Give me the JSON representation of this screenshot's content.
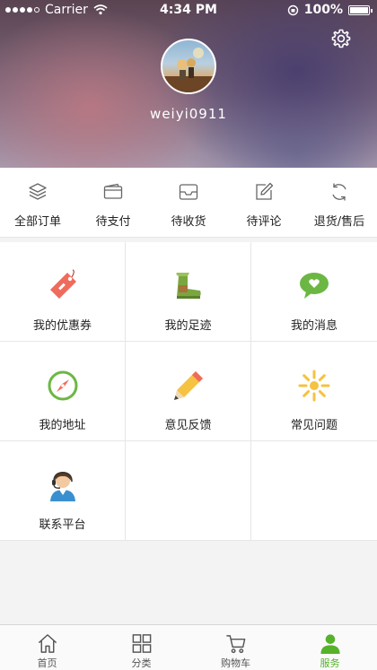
{
  "status_bar": {
    "carrier": "Carrier",
    "time": "4:34 PM",
    "battery": "100%",
    "battery_level": 1.0
  },
  "profile": {
    "username": "weiyi0911",
    "avatar_icon": "avatar-image",
    "settings_icon": "gear-icon"
  },
  "orders": [
    {
      "label": "全部订单",
      "icon": "layers-icon"
    },
    {
      "label": "待支付",
      "icon": "wallet-icon"
    },
    {
      "label": "待收货",
      "icon": "inbox-icon"
    },
    {
      "label": "待评论",
      "icon": "edit-icon"
    },
    {
      "label": "退货/售后",
      "icon": "refresh-icon"
    }
  ],
  "services": [
    {
      "label": "我的优惠券",
      "icon": "tag-icon"
    },
    {
      "label": "我的足迹",
      "icon": "boot-icon"
    },
    {
      "label": "我的消息",
      "icon": "message-heart-icon"
    },
    {
      "label": "我的地址",
      "icon": "compass-icon"
    },
    {
      "label": "意见反馈",
      "icon": "pencil-icon"
    },
    {
      "label": "常见问题",
      "icon": "sun-icon"
    },
    {
      "label": "联系平台",
      "icon": "support-agent-icon"
    }
  ],
  "tabbar": {
    "tabs": [
      {
        "label": "首页",
        "icon": "home-icon"
      },
      {
        "label": "分类",
        "icon": "grid-icon"
      },
      {
        "label": "购物车",
        "icon": "cart-icon"
      },
      {
        "label": "服务",
        "icon": "user-icon",
        "active": true
      }
    ],
    "active_color": "#56b22a"
  }
}
